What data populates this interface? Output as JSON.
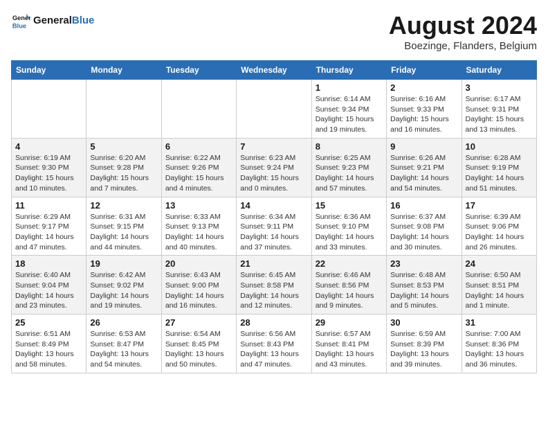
{
  "header": {
    "logo_line1": "General",
    "logo_line2": "Blue",
    "month_year": "August 2024",
    "location": "Boezinge, Flanders, Belgium"
  },
  "columns": [
    "Sunday",
    "Monday",
    "Tuesday",
    "Wednesday",
    "Thursday",
    "Friday",
    "Saturday"
  ],
  "weeks": [
    [
      {
        "day": "",
        "info": ""
      },
      {
        "day": "",
        "info": ""
      },
      {
        "day": "",
        "info": ""
      },
      {
        "day": "",
        "info": ""
      },
      {
        "day": "1",
        "info": "Sunrise: 6:14 AM\nSunset: 9:34 PM\nDaylight: 15 hours\nand 19 minutes."
      },
      {
        "day": "2",
        "info": "Sunrise: 6:16 AM\nSunset: 9:33 PM\nDaylight: 15 hours\nand 16 minutes."
      },
      {
        "day": "3",
        "info": "Sunrise: 6:17 AM\nSunset: 9:31 PM\nDaylight: 15 hours\nand 13 minutes."
      }
    ],
    [
      {
        "day": "4",
        "info": "Sunrise: 6:19 AM\nSunset: 9:30 PM\nDaylight: 15 hours\nand 10 minutes."
      },
      {
        "day": "5",
        "info": "Sunrise: 6:20 AM\nSunset: 9:28 PM\nDaylight: 15 hours\nand 7 minutes."
      },
      {
        "day": "6",
        "info": "Sunrise: 6:22 AM\nSunset: 9:26 PM\nDaylight: 15 hours\nand 4 minutes."
      },
      {
        "day": "7",
        "info": "Sunrise: 6:23 AM\nSunset: 9:24 PM\nDaylight: 15 hours\nand 0 minutes."
      },
      {
        "day": "8",
        "info": "Sunrise: 6:25 AM\nSunset: 9:23 PM\nDaylight: 14 hours\nand 57 minutes."
      },
      {
        "day": "9",
        "info": "Sunrise: 6:26 AM\nSunset: 9:21 PM\nDaylight: 14 hours\nand 54 minutes."
      },
      {
        "day": "10",
        "info": "Sunrise: 6:28 AM\nSunset: 9:19 PM\nDaylight: 14 hours\nand 51 minutes."
      }
    ],
    [
      {
        "day": "11",
        "info": "Sunrise: 6:29 AM\nSunset: 9:17 PM\nDaylight: 14 hours\nand 47 minutes."
      },
      {
        "day": "12",
        "info": "Sunrise: 6:31 AM\nSunset: 9:15 PM\nDaylight: 14 hours\nand 44 minutes."
      },
      {
        "day": "13",
        "info": "Sunrise: 6:33 AM\nSunset: 9:13 PM\nDaylight: 14 hours\nand 40 minutes."
      },
      {
        "day": "14",
        "info": "Sunrise: 6:34 AM\nSunset: 9:11 PM\nDaylight: 14 hours\nand 37 minutes."
      },
      {
        "day": "15",
        "info": "Sunrise: 6:36 AM\nSunset: 9:10 PM\nDaylight: 14 hours\nand 33 minutes."
      },
      {
        "day": "16",
        "info": "Sunrise: 6:37 AM\nSunset: 9:08 PM\nDaylight: 14 hours\nand 30 minutes."
      },
      {
        "day": "17",
        "info": "Sunrise: 6:39 AM\nSunset: 9:06 PM\nDaylight: 14 hours\nand 26 minutes."
      }
    ],
    [
      {
        "day": "18",
        "info": "Sunrise: 6:40 AM\nSunset: 9:04 PM\nDaylight: 14 hours\nand 23 minutes."
      },
      {
        "day": "19",
        "info": "Sunrise: 6:42 AM\nSunset: 9:02 PM\nDaylight: 14 hours\nand 19 minutes."
      },
      {
        "day": "20",
        "info": "Sunrise: 6:43 AM\nSunset: 9:00 PM\nDaylight: 14 hours\nand 16 minutes."
      },
      {
        "day": "21",
        "info": "Sunrise: 6:45 AM\nSunset: 8:58 PM\nDaylight: 14 hours\nand 12 minutes."
      },
      {
        "day": "22",
        "info": "Sunrise: 6:46 AM\nSunset: 8:56 PM\nDaylight: 14 hours\nand 9 minutes."
      },
      {
        "day": "23",
        "info": "Sunrise: 6:48 AM\nSunset: 8:53 PM\nDaylight: 14 hours\nand 5 minutes."
      },
      {
        "day": "24",
        "info": "Sunrise: 6:50 AM\nSunset: 8:51 PM\nDaylight: 14 hours\nand 1 minute."
      }
    ],
    [
      {
        "day": "25",
        "info": "Sunrise: 6:51 AM\nSunset: 8:49 PM\nDaylight: 13 hours\nand 58 minutes."
      },
      {
        "day": "26",
        "info": "Sunrise: 6:53 AM\nSunset: 8:47 PM\nDaylight: 13 hours\nand 54 minutes."
      },
      {
        "day": "27",
        "info": "Sunrise: 6:54 AM\nSunset: 8:45 PM\nDaylight: 13 hours\nand 50 minutes."
      },
      {
        "day": "28",
        "info": "Sunrise: 6:56 AM\nSunset: 8:43 PM\nDaylight: 13 hours\nand 47 minutes."
      },
      {
        "day": "29",
        "info": "Sunrise: 6:57 AM\nSunset: 8:41 PM\nDaylight: 13 hours\nand 43 minutes."
      },
      {
        "day": "30",
        "info": "Sunrise: 6:59 AM\nSunset: 8:39 PM\nDaylight: 13 hours\nand 39 minutes."
      },
      {
        "day": "31",
        "info": "Sunrise: 7:00 AM\nSunset: 8:36 PM\nDaylight: 13 hours\nand 36 minutes."
      }
    ]
  ]
}
